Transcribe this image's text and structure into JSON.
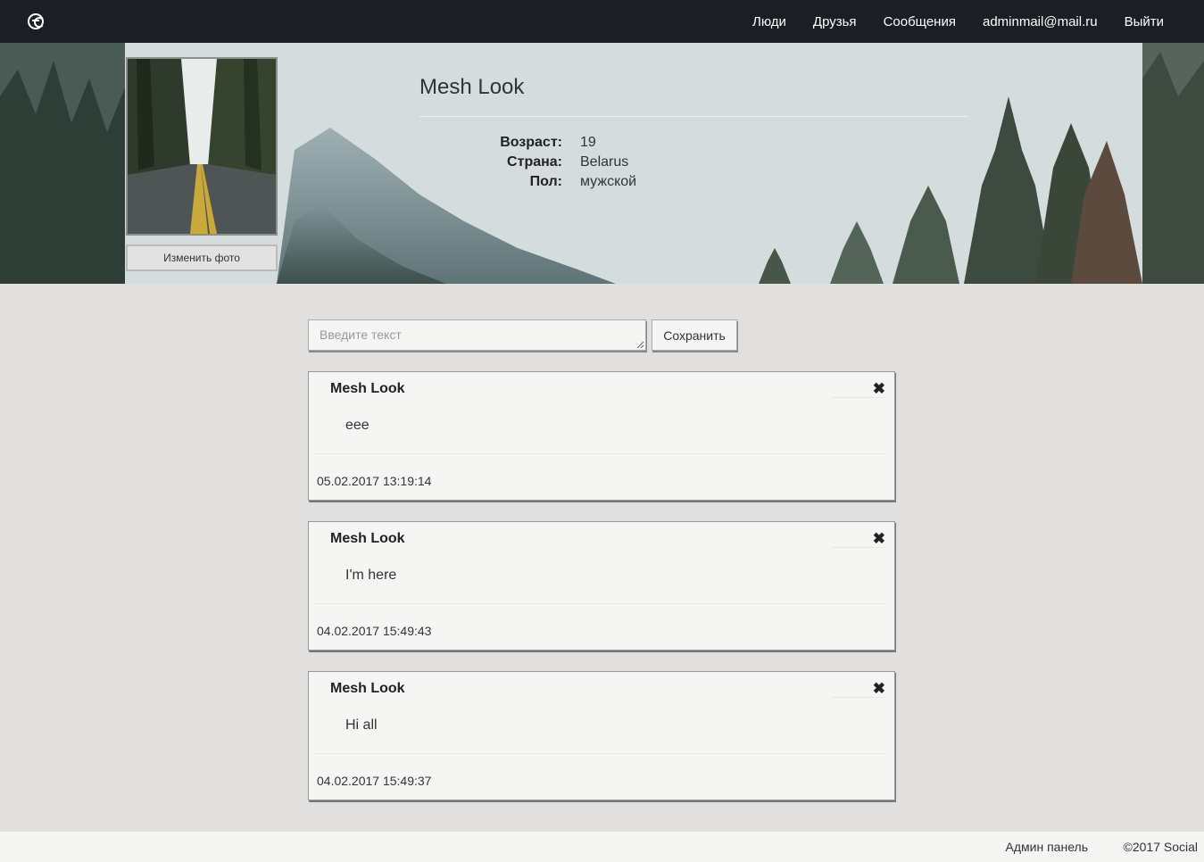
{
  "nav": {
    "logo_icon": "social-logo-icon",
    "people": "Люди",
    "friends": "Друзья",
    "messages": "Сообщения",
    "email": "adminmail@mail.ru",
    "logout": "Выйти"
  },
  "profile": {
    "name": "Mesh Look",
    "change_photo": "Изменить фото",
    "fields": [
      {
        "label": "Возраст:",
        "value": "19"
      },
      {
        "label": "Страна:",
        "value": "Belarus"
      },
      {
        "label": "Пол:",
        "value": "мужской"
      }
    ]
  },
  "composer": {
    "placeholder": "Введите текст",
    "value": "",
    "save_label": "Сохранить"
  },
  "posts": [
    {
      "author": "Mesh Look",
      "close": "✖",
      "text": "eee",
      "date": "05.02.2017 13:19:14"
    },
    {
      "author": "Mesh Look",
      "close": "✖",
      "text": "I'm here",
      "date": "04.02.2017 15:49:43"
    },
    {
      "author": "Mesh Look",
      "close": "✖",
      "text": "Hi all",
      "date": "04.02.2017 15:49:37"
    }
  ],
  "footer": {
    "admin": "Админ панель",
    "copyright": "©2017 Social"
  },
  "colors": {
    "navbar": "#1b1e24",
    "page_bg": "#e1e0de",
    "card_bg": "#f5f5f3"
  }
}
